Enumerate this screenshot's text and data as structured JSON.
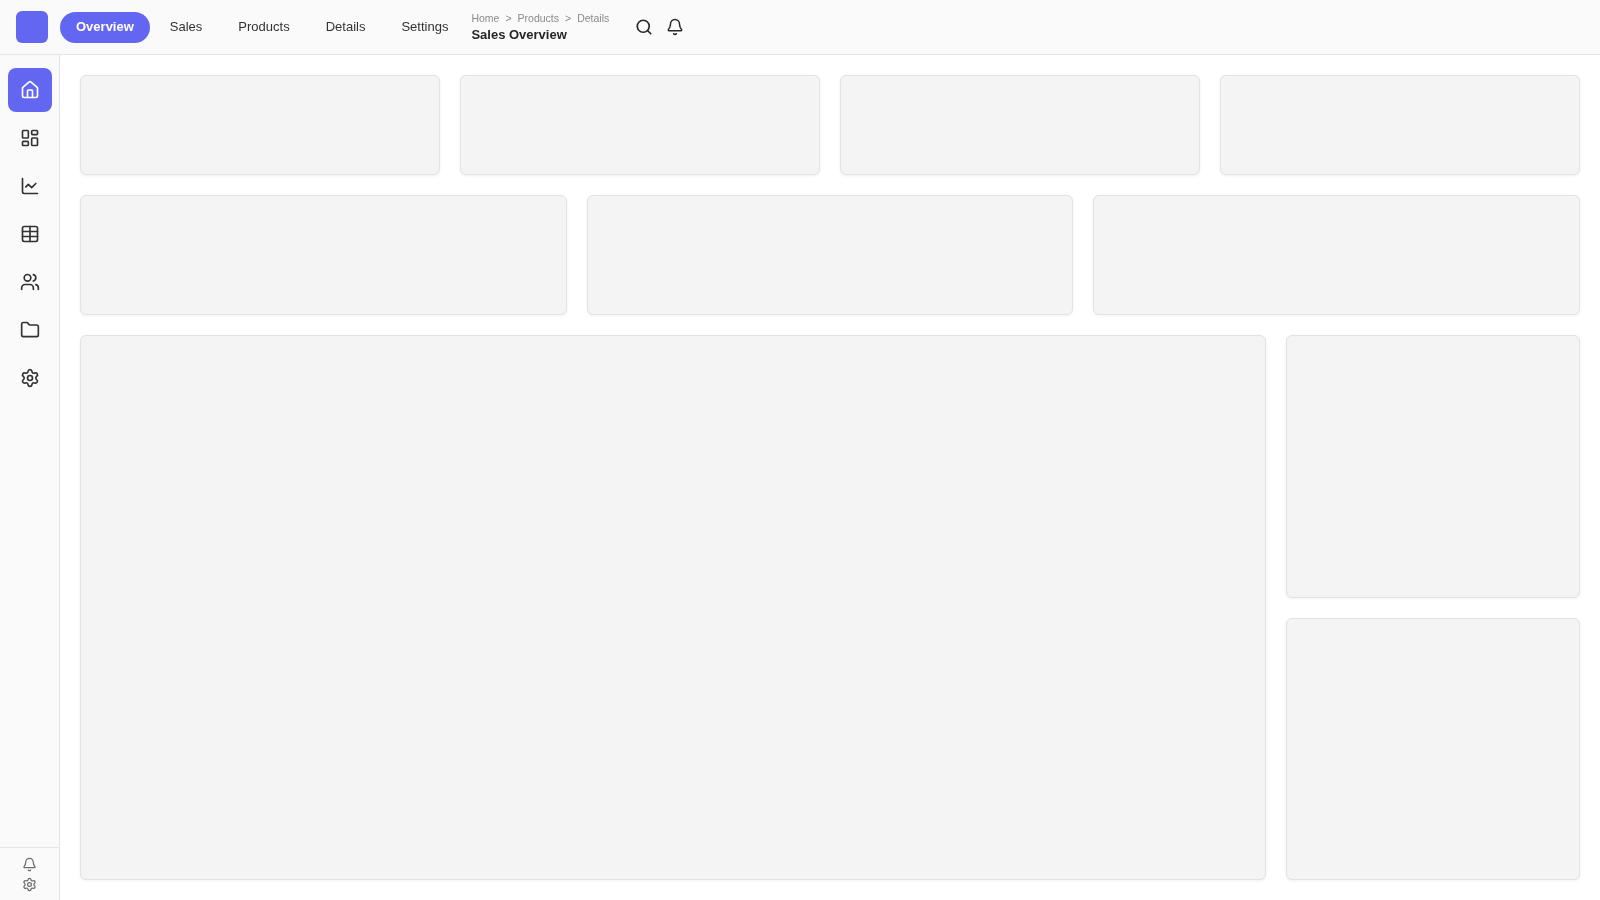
{
  "top_bar": {
    "tabs": [
      {
        "label": "Overview",
        "selected": true
      },
      {
        "label": "Sales",
        "selected": false
      },
      {
        "label": "Products",
        "selected": false
      },
      {
        "label": "Details",
        "selected": false
      },
      {
        "label": "Settings",
        "selected": false
      }
    ],
    "breadcrumb": [
      {
        "kind": "crumb",
        "text": "Home"
      },
      {
        "kind": "separator",
        "text": ">"
      },
      {
        "kind": "crumb",
        "text": "Products"
      },
      {
        "kind": "separator",
        "text": ">"
      },
      {
        "kind": "crumb",
        "text": "Details"
      }
    ],
    "page_title": "Sales Overview"
  },
  "sidebar": {
    "items": [
      {
        "selected": true
      },
      {
        "selected": false
      },
      {
        "selected": false
      },
      {
        "selected": false
      },
      {
        "selected": false
      },
      {
        "selected": false
      },
      {
        "selected": false
      }
    ]
  }
}
